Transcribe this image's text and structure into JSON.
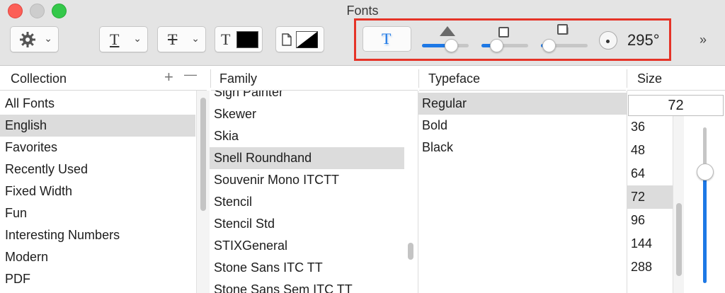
{
  "window": {
    "title": "Fonts"
  },
  "toolbar": {
    "action_menu_icon": "gear-icon",
    "underline_glyph": "T",
    "strikethrough_glyph": "T",
    "text_color_glyph": "T",
    "text_color": "#000000",
    "document_color": "#000000",
    "shadow_glyph": "T",
    "shadow_opacity": 0.6,
    "shadow_blur": 0.3,
    "shadow_offset": 0.15,
    "shadow_angle": "295°",
    "more_label": "»",
    "accent_color": "#1d78e5",
    "highlight_color": "#e53327"
  },
  "headers": {
    "collection": "Collection",
    "family": "Family",
    "typeface": "Typeface",
    "size": "Size",
    "add": "+",
    "remove": "—"
  },
  "collections": [
    {
      "label": "All Fonts"
    },
    {
      "label": "English"
    },
    {
      "label": "Favorites"
    },
    {
      "label": "Recently Used"
    },
    {
      "label": "Fixed Width"
    },
    {
      "label": "Fun"
    },
    {
      "label": "Interesting Numbers"
    },
    {
      "label": "Modern"
    },
    {
      "label": "PDF"
    }
  ],
  "collection_selected": "English",
  "families": [
    {
      "label": "Sign Painter"
    },
    {
      "label": "Skewer"
    },
    {
      "label": "Skia"
    },
    {
      "label": "Snell Roundhand"
    },
    {
      "label": "Souvenir Mono ITCTT"
    },
    {
      "label": "Stencil"
    },
    {
      "label": "Stencil Std"
    },
    {
      "label": "STIXGeneral"
    },
    {
      "label": "Stone Sans ITC TT"
    },
    {
      "label": "Stone Sans Sem ITC TT"
    }
  ],
  "family_selected": "Snell Roundhand",
  "typefaces": [
    {
      "label": "Regular"
    },
    {
      "label": "Bold"
    },
    {
      "label": "Black"
    }
  ],
  "typeface_selected": "Regular",
  "size_value": "72",
  "sizes": [
    {
      "label": "36"
    },
    {
      "label": "48"
    },
    {
      "label": "64"
    },
    {
      "label": "72"
    },
    {
      "label": "96"
    },
    {
      "label": "144"
    },
    {
      "label": "288"
    }
  ],
  "size_selected": "72",
  "size_slider_level": 0.72
}
